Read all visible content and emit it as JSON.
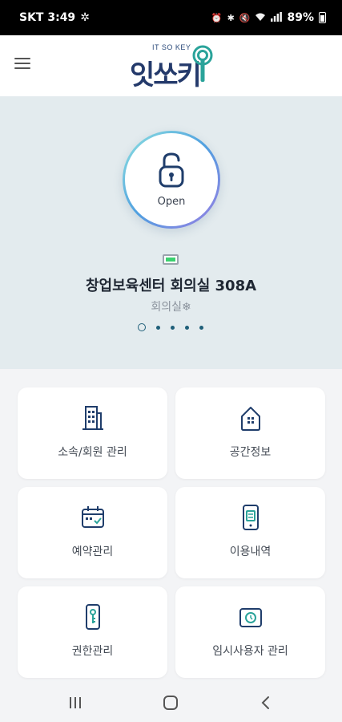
{
  "status_bar": {
    "carrier_time": "SKT 3:49",
    "battery": "89%"
  },
  "header": {
    "logo_sub": "IT SO KEY",
    "logo_main": "잇쏘키",
    "menu_icon": "hamburger-icon"
  },
  "hero": {
    "open_label": "Open",
    "room_name": "창업보육센터 회의실 308A",
    "room_type": "회의실",
    "page_count": 5,
    "active_page": 0
  },
  "menu": [
    {
      "label": "소속/회원 관리",
      "icon": "building-icon"
    },
    {
      "label": "공간정보",
      "icon": "house-icon"
    },
    {
      "label": "예약관리",
      "icon": "calendar-icon"
    },
    {
      "label": "이용내역",
      "icon": "phone-history-icon"
    },
    {
      "label": "권한관리",
      "icon": "key-device-icon"
    },
    {
      "label": "임시사용자 관리",
      "icon": "temp-user-icon"
    }
  ],
  "colors": {
    "accent": "#1f3d6b",
    "hero_bg": "#e3ebee",
    "battery_green": "#3bd16f"
  }
}
